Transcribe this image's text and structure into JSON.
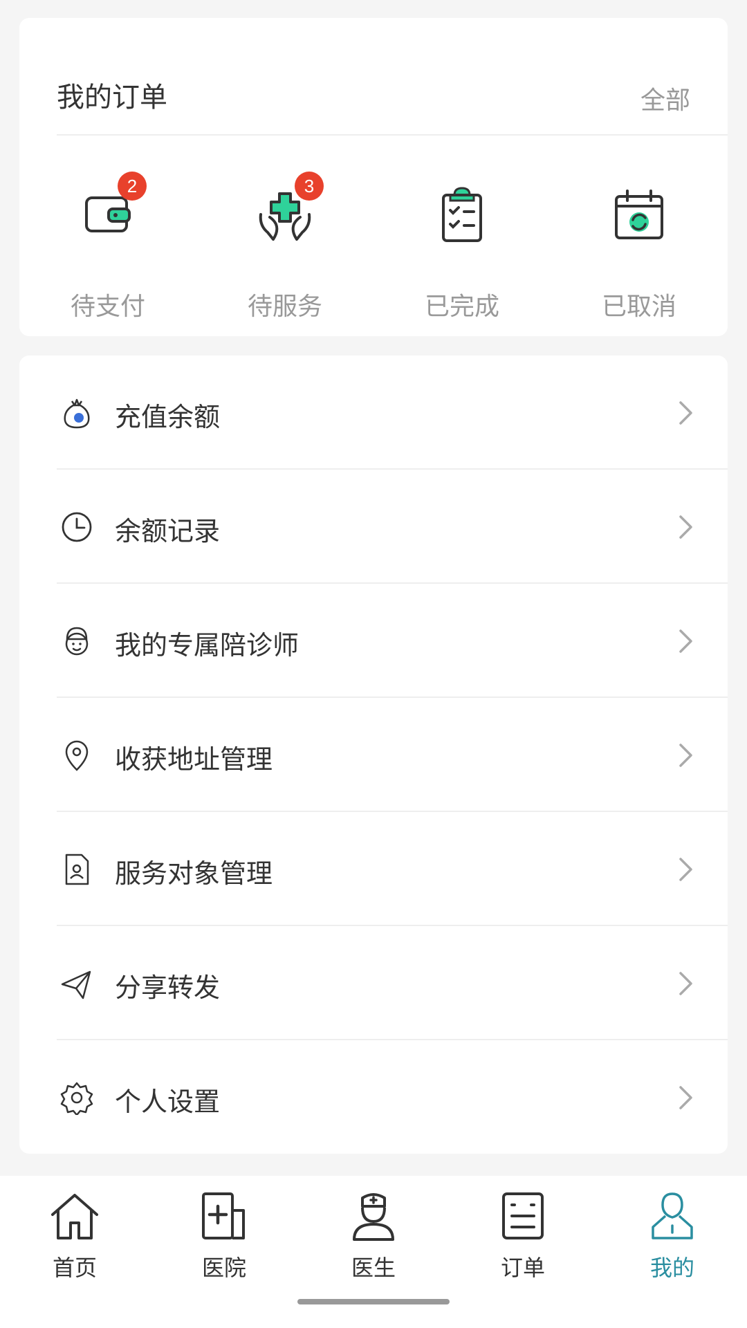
{
  "orders": {
    "title": "我的订单",
    "all_link": "全部",
    "items": [
      {
        "label": "待支付",
        "icon": "wallet-icon",
        "badge": "2"
      },
      {
        "label": "待服务",
        "icon": "care-hands-icon",
        "badge": "3"
      },
      {
        "label": "已完成",
        "icon": "checklist-icon",
        "badge": ""
      },
      {
        "label": "已取消",
        "icon": "calendar-refresh-icon",
        "badge": ""
      }
    ]
  },
  "menu": {
    "items": [
      {
        "label": "充值余额",
        "icon": "money-bag-icon"
      },
      {
        "label": "余额记录",
        "icon": "clock-icon"
      },
      {
        "label": "我的专属陪诊师",
        "icon": "nurse-face-icon"
      },
      {
        "label": "收获地址管理",
        "icon": "location-pin-icon"
      },
      {
        "label": "服务对象管理",
        "icon": "person-document-icon"
      },
      {
        "label": "分享转发",
        "icon": "paper-plane-icon"
      },
      {
        "label": "个人设置",
        "icon": "gear-icon"
      }
    ]
  },
  "tabbar": {
    "items": [
      {
        "label": "首页",
        "icon": "home-icon"
      },
      {
        "label": "医院",
        "icon": "hospital-icon"
      },
      {
        "label": "医生",
        "icon": "doctor-icon"
      },
      {
        "label": "订单",
        "icon": "order-list-icon"
      },
      {
        "label": "我的",
        "icon": "profile-icon"
      }
    ],
    "active_index": 4
  },
  "colors": {
    "accent": "#2a8ea0",
    "icon_green": "#2fd29a",
    "badge_red": "#e8412c",
    "muted_text": "#999999"
  }
}
